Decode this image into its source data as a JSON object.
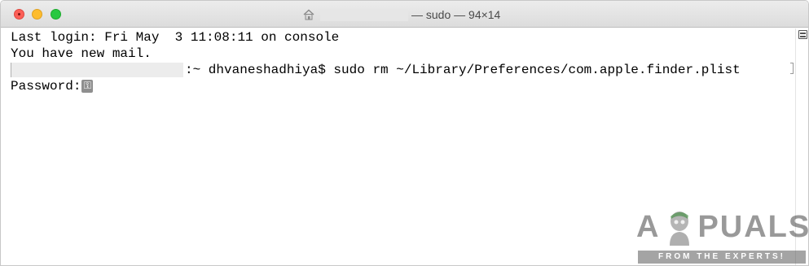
{
  "window": {
    "title": "— sudo — 94×14",
    "controls": {
      "close": "close-button",
      "minimize": "minimize-button",
      "zoom": "zoom-button"
    },
    "title_icon": "home-folder-icon"
  },
  "terminal": {
    "lines": [
      "Last login: Fri May  3 11:08:11 on console",
      "You have new mail."
    ],
    "prompt": ":~ dhvaneshadhiya$ sudo rm ~/Library/Preferences/com.apple.finder.plist",
    "password_label": "Password:",
    "cursor_icon": "key-cursor-icon"
  },
  "watermark": {
    "letters_a": "A",
    "letters_rest": "PUALS",
    "subtitle": "FROM THE EXPERTS!"
  },
  "colors": {
    "close": "#fc5f57",
    "minimize": "#fdbc2e",
    "zoom": "#28c840",
    "text": "#000000",
    "titlebar": "#e3e3e3"
  }
}
